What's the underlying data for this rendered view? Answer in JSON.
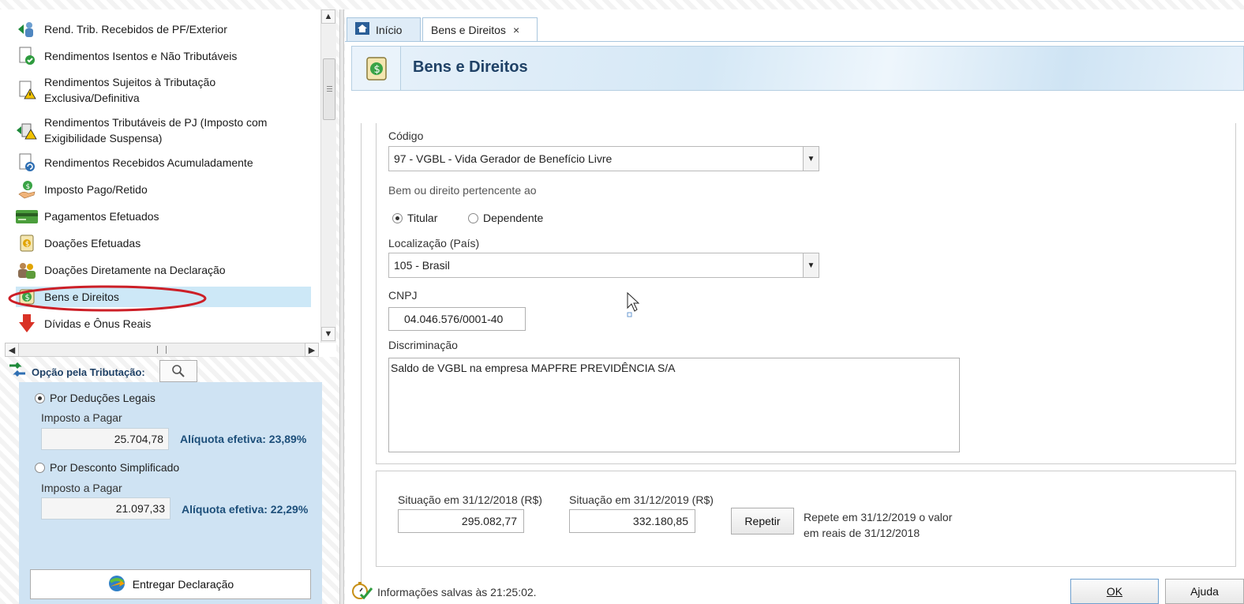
{
  "nav": {
    "items": [
      {
        "label": "Rend. Trib. Recebidos de PF/Exterior",
        "icon": "person-arrow-icon"
      },
      {
        "label": "Rendimentos Isentos e Não Tributáveis",
        "icon": "document-check-icon"
      },
      {
        "label": "Rendimentos Sujeitos à Tributação",
        "label2": "Exclusiva/Definitiva",
        "icon": "document-warning-icon"
      },
      {
        "label": "Rendimentos Tributáveis de PJ (Imposto com",
        "label2": "Exigibilidade Suspensa)",
        "icon": "building-warning-icon"
      },
      {
        "label": "Rendimentos Recebidos Acumuladamente",
        "icon": "document-refresh-icon"
      },
      {
        "label": "Imposto Pago/Retido",
        "icon": "hand-coin-icon"
      },
      {
        "label": "Pagamentos Efetuados",
        "icon": "credit-card-icon"
      },
      {
        "label": "Doações Efetuadas",
        "icon": "money-document-icon"
      },
      {
        "label": "Doações Diretamente na Declaração",
        "icon": "people-icon"
      },
      {
        "label": "Bens e Direitos",
        "icon": "money-bag-icon",
        "selected": true
      },
      {
        "label": "Dívidas e Ônus Reais",
        "icon": "red-arrow-down-icon"
      }
    ]
  },
  "opcao": {
    "title": "Opção pela Tributação:",
    "legais": {
      "label": "Por Deduções Legais",
      "imposto_label": "Imposto a Pagar",
      "value": "25.704,78",
      "aliquota": "Alíquota efetiva: 23,89%",
      "selected": true
    },
    "simplificado": {
      "label": "Por Desconto Simplificado",
      "imposto_label": "Imposto a Pagar",
      "value": "21.097,33",
      "aliquota": "Alíquota efetiva: 22,29%",
      "selected": false
    },
    "entregar_label": "Entregar Declaração"
  },
  "tabs": [
    {
      "label": "Início",
      "active": false
    },
    {
      "label": "Bens e Direitos",
      "active": true,
      "close": "×"
    }
  ],
  "page": {
    "title": "Bens e Direitos"
  },
  "form": {
    "codigo_label": "Código",
    "codigo_value": "97 - VGBL - Vida Gerador de Benefício Livre",
    "pertencente_label": "Bem ou direito pertencente ao",
    "titular_label": "Titular",
    "dependente_label": "Dependente",
    "titular_selected": true,
    "localizacao_label": "Localização (País)",
    "localizacao_value": "105 - Brasil",
    "cnpj_label": "CNPJ",
    "cnpj_value": "04.046.576/0001-40",
    "discriminacao_label": "Discriminação",
    "discriminacao_value": "Saldo de VGBL na empresa MAPFRE PREVIDÊNCIA S/A"
  },
  "situacao": {
    "label_2018": "Situação em 31/12/2018 (R$)",
    "value_2018": "295.082,77",
    "label_2019": "Situação em 31/12/2019 (R$)",
    "value_2019": "332.180,85",
    "repetir_label": "Repetir",
    "repete_text_1": "Repete em 31/12/2019 o valor",
    "repete_text_2": "em reais de 31/12/2018"
  },
  "status": {
    "text": "Informações salvas às 21:25:02."
  },
  "buttons": {
    "ok": "OK",
    "ajuda": "Ajuda"
  },
  "colors": {
    "selection": "#cde8f7",
    "highlight_ellipse": "#cc1f27",
    "panel_blue": "#cfe3f3",
    "title_blue": "#1f4166"
  }
}
